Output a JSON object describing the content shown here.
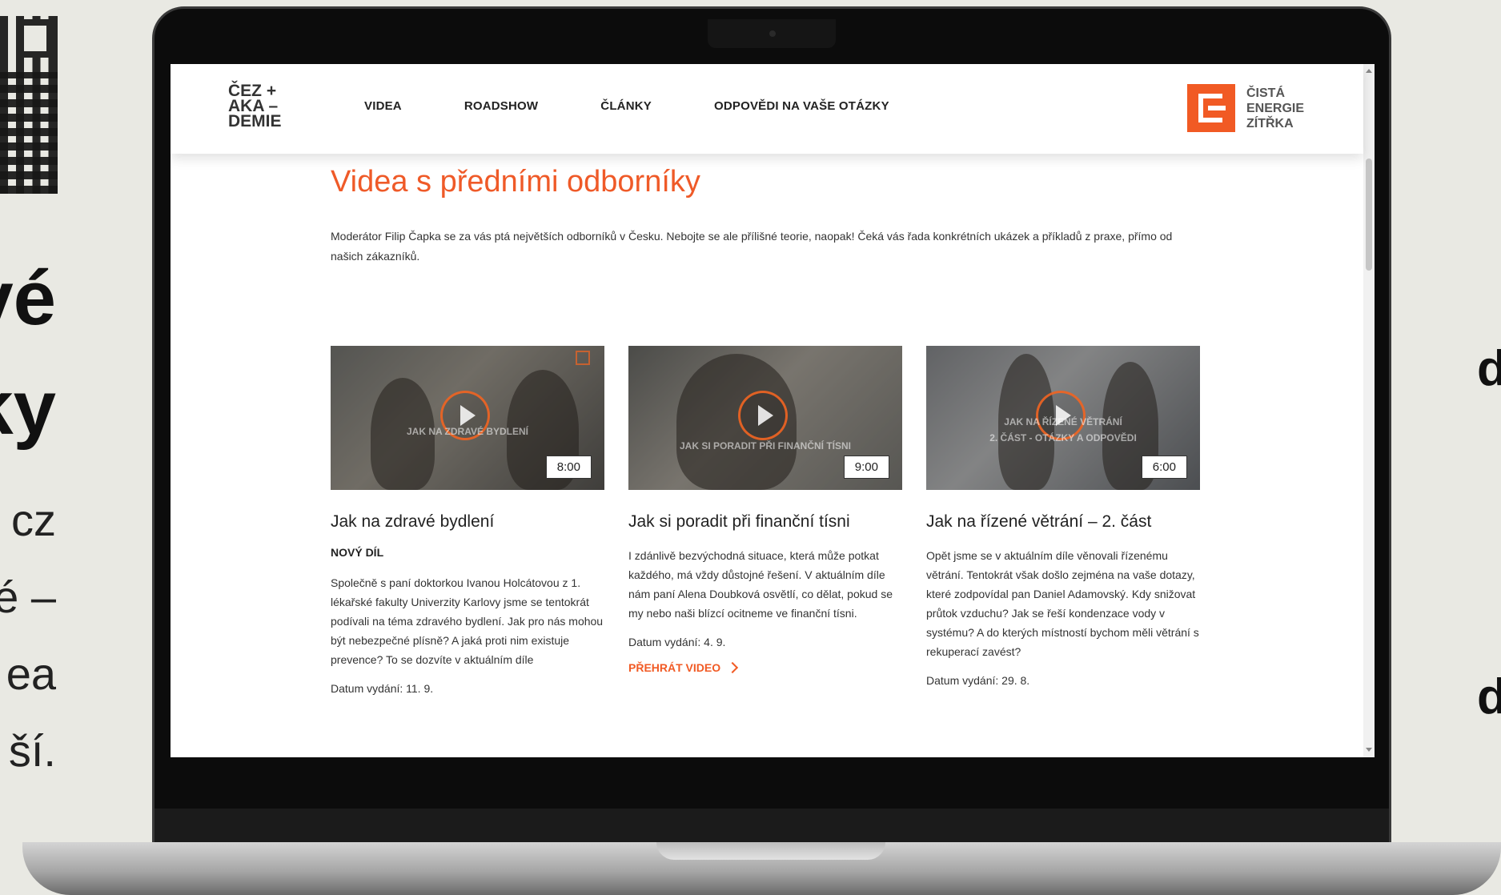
{
  "slide": {
    "left_big_1": "vé",
    "left_big_2": "ky",
    "left_lines": [
      "cz",
      "é –",
      "ea",
      "ší."
    ],
    "right_big_1": "d",
    "right_big_2": "d"
  },
  "site": {
    "logo_lines": [
      "ČEZ +",
      "AKA –",
      "DEMIE"
    ],
    "nav": [
      "VIDEA",
      "ROADSHOW",
      "ČLÁNKY",
      "ODPOVĚDI NA VAŠE OTÁZKY"
    ],
    "brand_lines": [
      "ČISTÁ",
      "ENERGIE",
      "ZÍTŘKA"
    ]
  },
  "page": {
    "title": "Videa s předními odborníky",
    "intro": "Moderátor Filip Čapka se za vás ptá největších odborníků v Česku. Nebojte se ale přílišné teorie, naopak! Čeká vás řada konkrétních ukázek a příkladů z praxe, přímo od našich zákazníků."
  },
  "videos": [
    {
      "overlay": "JAK NA ZDRAVÉ BYDLENÍ",
      "duration": "8:00",
      "title": "Jak na zdravé bydlení",
      "badge": "NOVÝ DÍL",
      "description": "Společně s paní doktorkou Ivanou Holcátovou z 1. lékařské fakulty Univerzity Karlovy jsme se tentokrát podívali na téma zdravého bydlení. Jak pro nás mohou být nebezpečné plísně? A jaká proti nim existuje prevence? To se dozvíte v aktuálním díle",
      "date": "Datum vydání: 11. 9."
    },
    {
      "overlay": "JAK SI PORADIT PŘI FINANČNÍ TÍSNI",
      "duration": "9:00",
      "title": "Jak si poradit při finanční tísni",
      "description": "I zdánlivě bezvýchodná situace, která může potkat každého, má vždy důstojné řešení. V aktuálním díle nám paní Alena Doubková osvětlí, co dělat, pokud se my nebo naši blízcí ocitneme ve finanční tísni.",
      "date": "Datum vydání: 4. 9.",
      "play_label": "PŘEHRÁT VIDEO"
    },
    {
      "overlay_1": "JAK NA ŘÍZENÉ VĚTRÁNÍ",
      "overlay_2": "2. ČÁST - OTÁZKY A ODPOVĚDI",
      "duration": "6:00",
      "title": "Jak na řízené větrání – 2. část",
      "description": "Opět jsme se v aktuálním díle věnovali řízenému větrání. Tentokrát však došlo zejména na vaše dotazy, které zodpovídal pan Daniel Adamovský. Kdy snižovat průtok vzduchu? Jak se řeší kondenzace vody v systému? A do kterých místností bychom měli větrání s rekuperací zavést?",
      "date": "Datum vydání: 29. 8."
    }
  ]
}
